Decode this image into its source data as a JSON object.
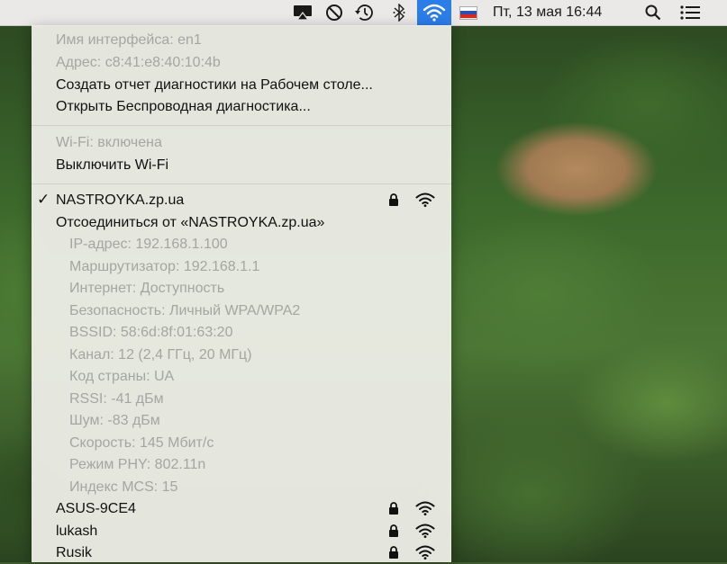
{
  "menubar": {
    "date_time": "Пт, 13 мая  16:44",
    "flag_colors": [
      "#ffffff",
      "#2e4fb3",
      "#d52b1e"
    ],
    "icons": [
      "airplay-icon",
      "do-not-disturb-icon",
      "time-machine-icon",
      "bluetooth-icon",
      "wifi-icon",
      "input-source-flag-icon",
      "spotlight-search-icon",
      "notification-center-icon"
    ],
    "accent": "#2b7de9"
  },
  "wifi_menu": {
    "info": {
      "interface_name": "Имя интерфейса: en1",
      "address": "Адрес: c8:41:e8:40:10:4b"
    },
    "actions": {
      "create_report": "Создать отчет диагностики на Рабочем столе...",
      "open_diagnostics": "Открыть Беспроводная диагностика..."
    },
    "status": {
      "wifi_state": "Wi-Fi: включена",
      "turn_off": "Выключить Wi-Fi"
    },
    "connected": {
      "ssid": "NASTROYKA.zp.ua",
      "disconnect": "Отсоединиться от «NASTROYKA.zp.ua»",
      "details": [
        "IP-адрес: 192.168.1.100",
        "Маршрутизатор: 192.168.1.1",
        "Интернет: Доступность",
        "Безопасность: Личный WPA/WPA2",
        "BSSID: 58:6d:8f:01:63:20",
        "Канал: 12 (2,4 ГГц, 20 МГц)",
        "Код страны: UA",
        "RSSI: -41 дБм",
        "Шум: -83 дБм",
        "Скорость: 145 Мбит/с",
        "Режим PHY: 802.11n",
        "Индекс MCS: 15"
      ]
    },
    "networks": [
      {
        "name": "ASUS-9CE4"
      },
      {
        "name": "lukash"
      },
      {
        "name": "Rusik"
      }
    ]
  }
}
